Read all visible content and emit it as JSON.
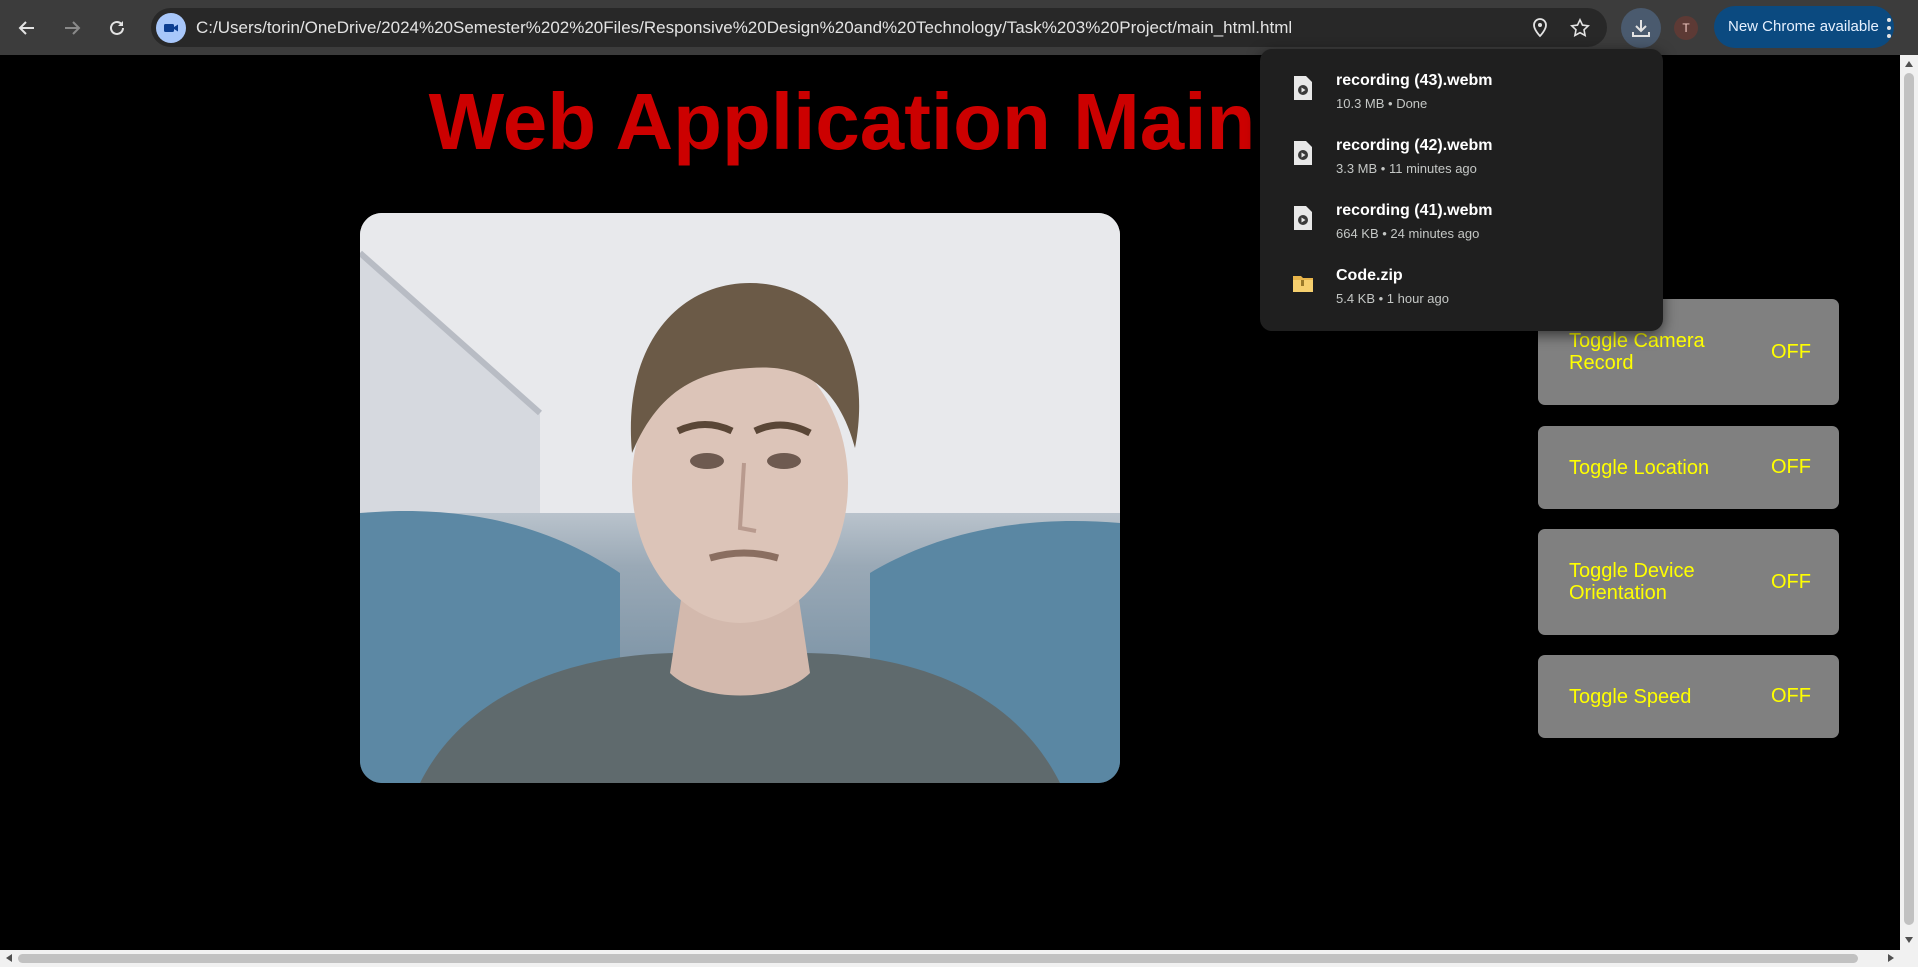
{
  "browser": {
    "url": "C:/Users/torin/OneDrive/2024%20Semester%202%20Files/Responsive%20Design%20and%20Technology/Task%203%20Project/main_html.html",
    "profile_initial": "T",
    "update_label": "New Chrome available",
    "icons": [
      "back-icon",
      "forward-icon",
      "reload-icon",
      "camera-site-icon",
      "location-icon",
      "star-icon",
      "download-icon",
      "menu-icon"
    ]
  },
  "page": {
    "title": "Web Application Main",
    "toggles": [
      {
        "label": "Toggle Camera Record",
        "state": "OFF"
      },
      {
        "label": "Toggle Location",
        "state": "OFF"
      },
      {
        "label": "Toggle Device Orientation",
        "state": "OFF"
      },
      {
        "label": "Toggle Speed",
        "state": "OFF"
      }
    ]
  },
  "downloads": [
    {
      "name": "recording (43).webm",
      "meta": "10.3 MB • Done",
      "type": "video"
    },
    {
      "name": "recording (42).webm",
      "meta": "3.3 MB • 11 minutes ago",
      "type": "video"
    },
    {
      "name": "recording (41).webm",
      "meta": "664 KB • 24 minutes ago",
      "type": "video"
    },
    {
      "name": "Code.zip",
      "meta": "5.4 KB • 1 hour ago",
      "type": "zip"
    }
  ],
  "colors": {
    "title": "#cc0000",
    "toggle_bg": "#808080",
    "toggle_text": "#ffff00",
    "page_bg": "#000000",
    "update_button": "#0b4a80"
  }
}
